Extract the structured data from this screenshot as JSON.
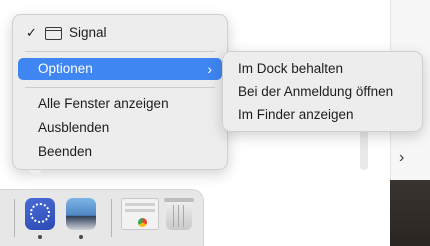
{
  "context_menu": {
    "app_name": "Signal",
    "options_label": "Optionen",
    "show_all_windows": "Alle Fenster anzeigen",
    "hide": "Ausblenden",
    "quit": "Beenden"
  },
  "submenu": {
    "keep_in_dock": "Im Dock behalten",
    "open_at_login": "Bei der Anmeldung öffnen",
    "show_in_finder": "Im Finder anzeigen"
  },
  "icons": {
    "checkmark": "✓",
    "submenu_arrow": "›",
    "window_chevron": "›"
  },
  "colors": {
    "highlight": "#3f86f2",
    "menu_bg": "#ececec"
  }
}
